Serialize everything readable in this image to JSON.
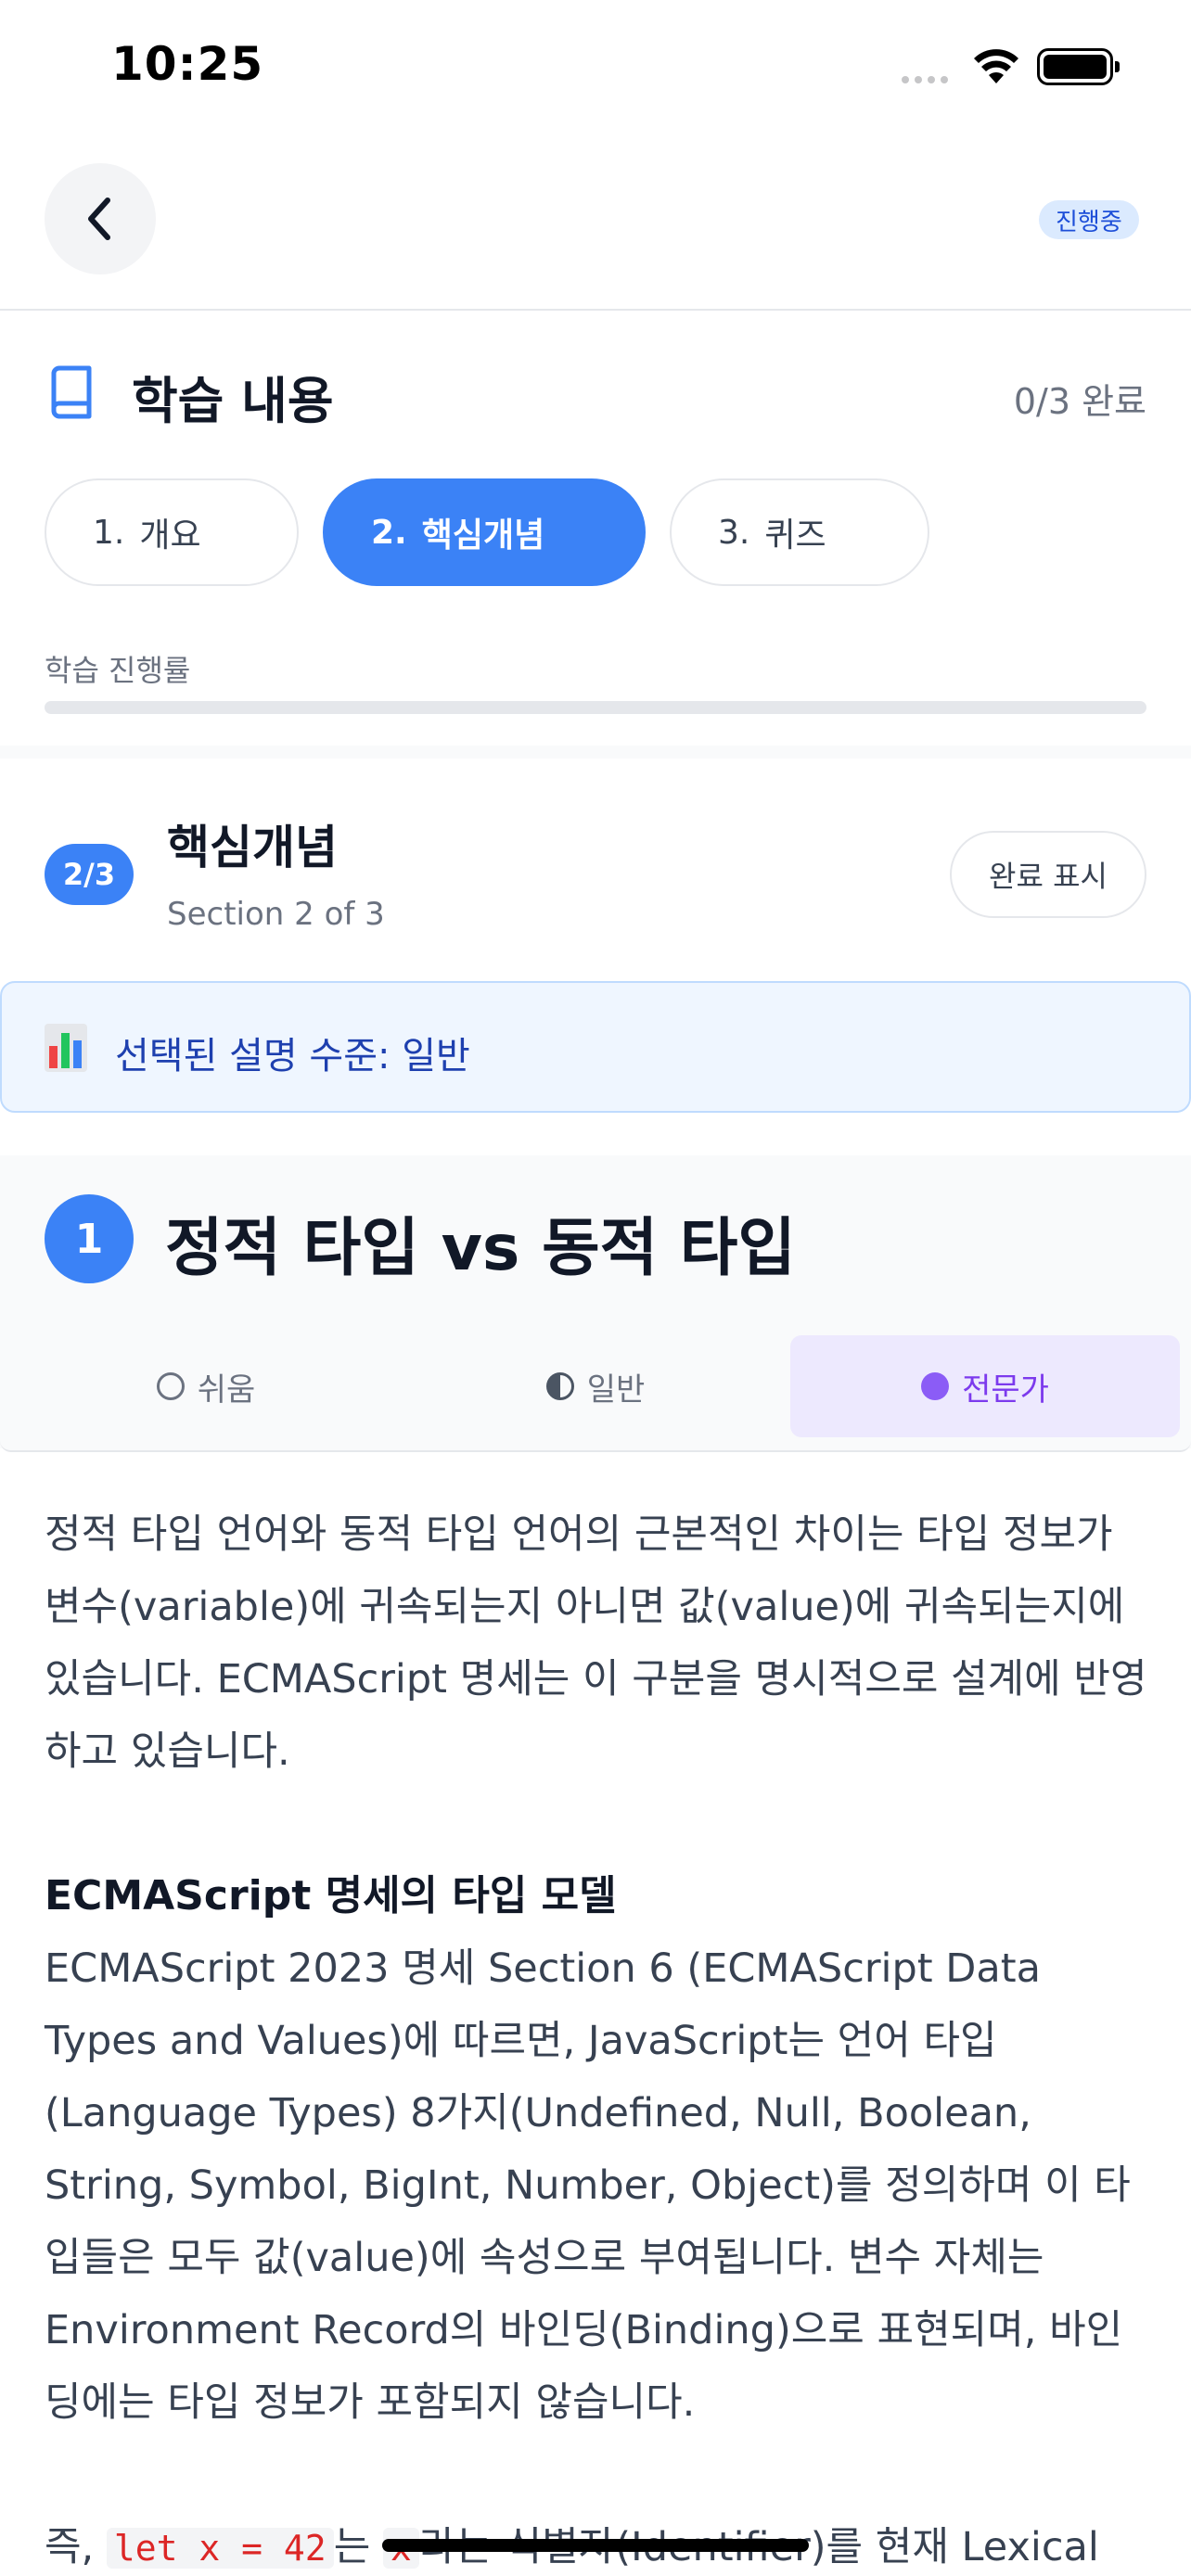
{
  "status_bar": {
    "time": "10:25"
  },
  "nav": {
    "status": "진행중"
  },
  "section_header": {
    "title": "학습 내용",
    "progress": "0/3 완료"
  },
  "tabs": [
    {
      "num": "1.",
      "label": "개요",
      "active": false
    },
    {
      "num": "2.",
      "label": "핵심개념",
      "active": true
    },
    {
      "num": "3.",
      "label": "퀴즈",
      "active": false
    }
  ],
  "progress": {
    "label": "학습 진행률",
    "value": 0
  },
  "section": {
    "badge": "2/3",
    "title": "핵심개념",
    "subtitle": "Section 2 of 3",
    "mark_done_label": "완료 표시"
  },
  "level_banner": {
    "text": "선택된 설명 수준: 일반"
  },
  "topic": {
    "number": "1",
    "title": "정적 타입 vs 동적 타입"
  },
  "levels": [
    {
      "label": "쉬움",
      "selected": false
    },
    {
      "label": "일반",
      "selected": false
    },
    {
      "label": "전문가",
      "selected": true
    }
  ],
  "content": {
    "intro": "정적 타입 언어와 동적 타입 언어의 근본적인 차이는 타입 정보가 변수(variable)에 귀속되는지 아니면 값(value)에 귀속되는지에 있습니다. ECMAScript 명세는 이 구분을 명시적으로 설계에 반영하고 있습니다.",
    "heading": "ECMAScript 명세의 타입 모델",
    "body": "ECMAScript 2023 명세 Section 6 (ECMAScript Data Types and Values)에 따르면, JavaScript는 언어 타입(Language Types) 8가지(Undefined, Null, Boolean, String, Symbol, BigInt, Number, Object)를 정의하며 이 타입들은 모두 값(value)에 속성으로 부여됩니다. 변수 자체는 Environment Record의 바인딩(Binding)으로 표현되며, 바인딩에는 타입 정보가 포함되지 않습니다.",
    "last_prefix": "즉, ",
    "code1": "let x = 42",
    "last_mid": "는 ",
    "code2": "x",
    "last_suffix": "라는 식별자(Identifier)를 현재 Lexical"
  }
}
